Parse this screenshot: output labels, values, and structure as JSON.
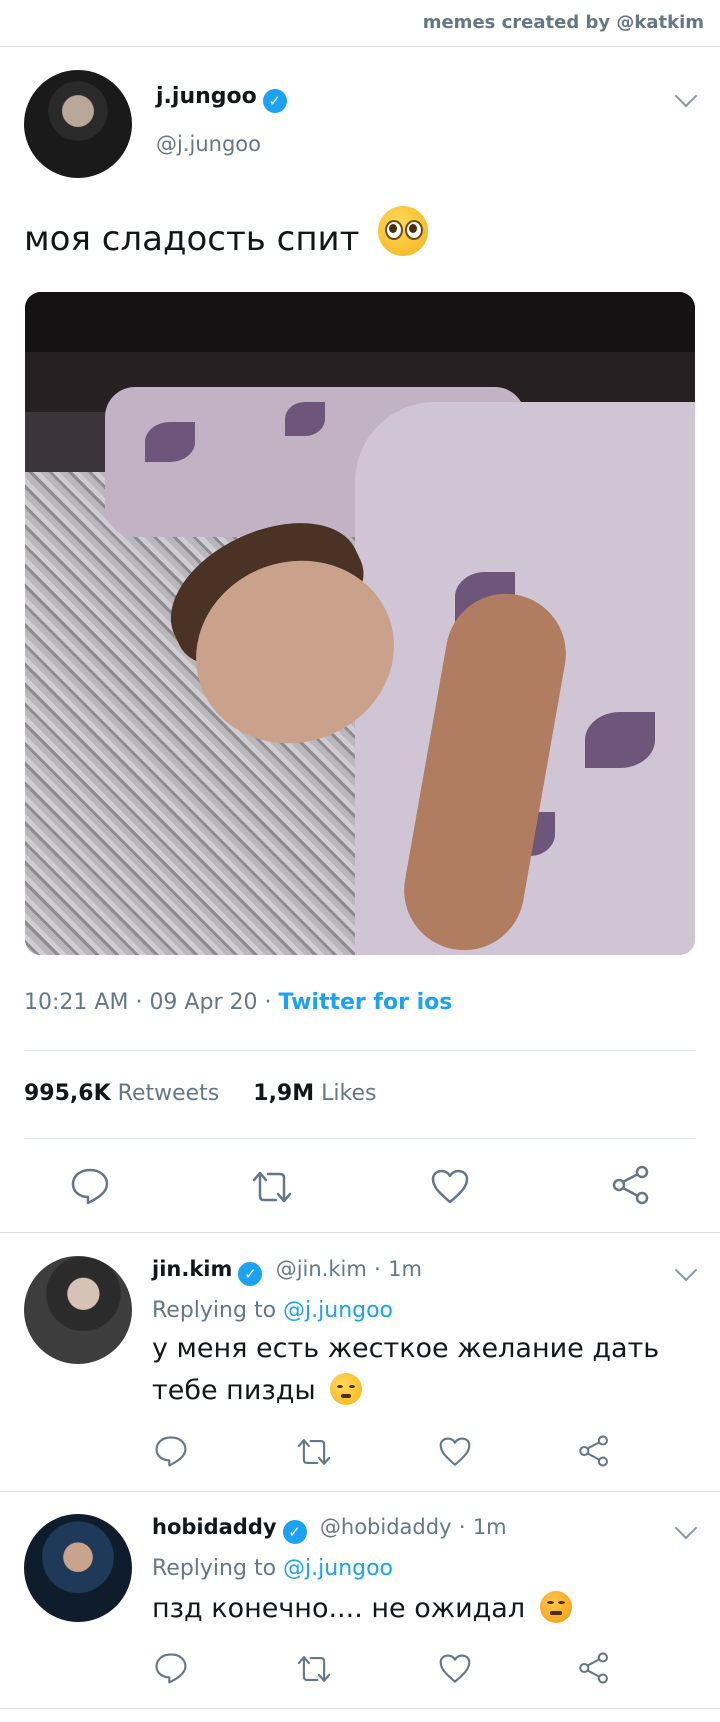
{
  "credit": "memes created by @katkim",
  "main_tweet": {
    "name": "j.jungoo",
    "handle": "@j.jungoo",
    "text": "моя сладость спит",
    "time": "10:21 AM",
    "date": "09 Apr 20",
    "source": "Twitter for ios",
    "retweets_count": "995,6K",
    "retweets_label": "Retweets",
    "likes_count": "1,9M",
    "likes_label": "Likes"
  },
  "replies": [
    {
      "name": "jin.kim",
      "handle": "@jin.kim",
      "time": "1m",
      "replying_label": "Replying to",
      "replying_to": "@j.jungoo",
      "text_line1": "у меня есть жесткое желание дать",
      "text_line2": "тебе пизды"
    },
    {
      "name": "hobidaddy",
      "handle": "@hobidaddy",
      "time": "1m",
      "replying_label": "Replying to",
      "replying_to": "@j.jungoo",
      "text_line1": "пзд конечно.... не ожидал"
    }
  ],
  "separator": "·",
  "verified_mark": "✓",
  "icons": [
    "reply-icon",
    "retweet-icon",
    "like-icon",
    "share-icon",
    "verified-badge-icon",
    "chevron-down-icon"
  ],
  "colors": {
    "accent": "#1da1f2",
    "secondary_text": "#657786",
    "divider": "#e1e8ed"
  }
}
